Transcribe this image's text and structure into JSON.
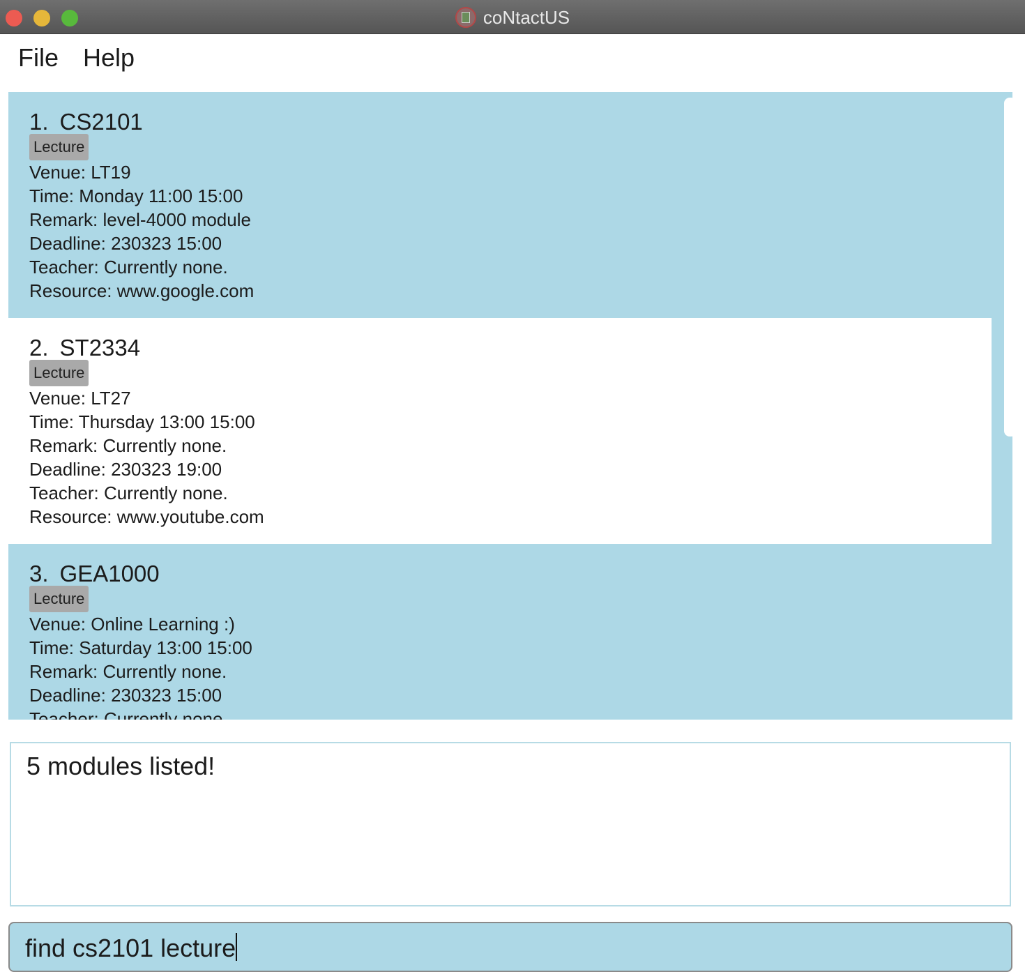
{
  "window": {
    "title": "coNtactUS",
    "app_icon": "address-book-icon"
  },
  "menu": {
    "file_label": "File",
    "help_label": "Help"
  },
  "modules": [
    {
      "index": "1.",
      "code": "CS2101",
      "tag": "Lecture",
      "venue": "Venue: LT19",
      "time": "Time: Monday 11:00 15:00",
      "remark": "Remark: level-4000 module",
      "deadline": "Deadline: 230323 15:00",
      "teacher": "Teacher: Currently none.",
      "resource": "Resource: www.google.com"
    },
    {
      "index": "2.",
      "code": "ST2334",
      "tag": "Lecture",
      "venue": "Venue: LT27",
      "time": "Time: Thursday 13:00 15:00",
      "remark": "Remark: Currently none.",
      "deadline": "Deadline: 230323 19:00",
      "teacher": "Teacher: Currently none.",
      "resource": "Resource: www.youtube.com"
    },
    {
      "index": "3.",
      "code": "GEA1000",
      "tag": "Lecture",
      "venue": "Venue: Online Learning :)",
      "time": "Time: Saturday 13:00 15:00",
      "remark": "Remark: Currently none.",
      "deadline": "Deadline: 230323 15:00",
      "teacher": "Teacher: Currently none."
    }
  ],
  "result": {
    "message": "5 modules listed!"
  },
  "command": {
    "value": "find cs2101 lecture"
  },
  "colors": {
    "list_background": "#add8e6",
    "command_background": "#add8e6",
    "tag_background": "#a9a9a9"
  }
}
